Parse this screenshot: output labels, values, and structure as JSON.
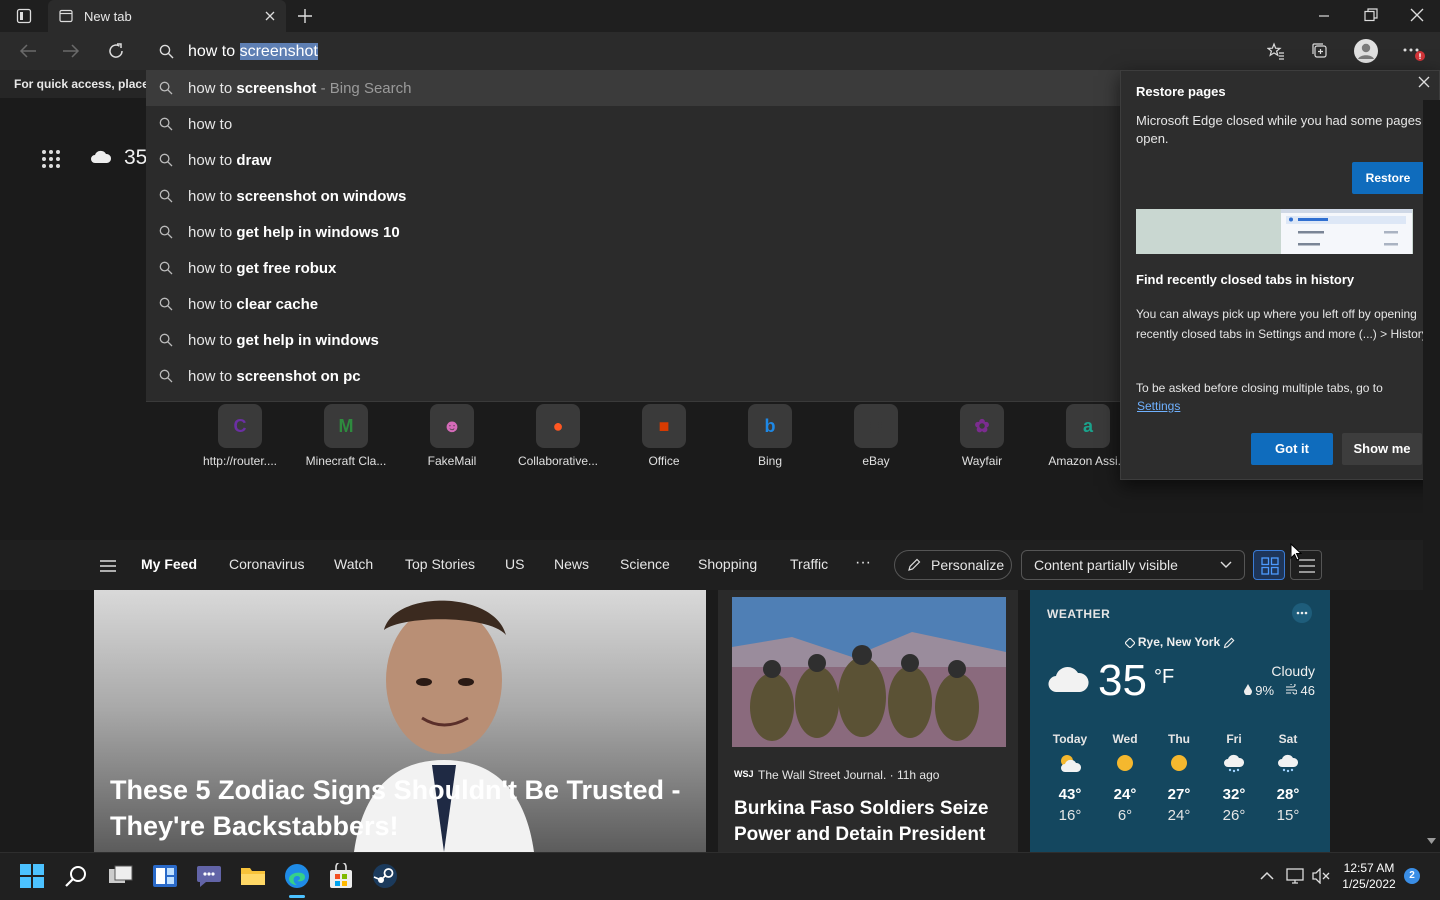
{
  "browser": {
    "tab_title": "New tab",
    "address_typed": "how to ",
    "address_selected": "screenshot",
    "favorites_hint": "For quick access, place y",
    "accent": "#0f6cbd"
  },
  "suggestions": [
    {
      "prefix": "how to ",
      "bold": "screenshot",
      "tail": " - Bing Search"
    },
    {
      "prefix": "how to",
      "bold": "",
      "tail": ""
    },
    {
      "prefix": "how to ",
      "bold": "draw",
      "tail": ""
    },
    {
      "prefix": "how to ",
      "bold": "screenshot on windows",
      "tail": ""
    },
    {
      "prefix": "how to ",
      "bold": "get help in windows 10",
      "tail": ""
    },
    {
      "prefix": "how to ",
      "bold": "get free robux",
      "tail": ""
    },
    {
      "prefix": "how to ",
      "bold": "clear cache",
      "tail": ""
    },
    {
      "prefix": "how to ",
      "bold": "get help in windows",
      "tail": ""
    },
    {
      "prefix": "how to ",
      "bold": "screenshot on pc",
      "tail": ""
    }
  ],
  "page": {
    "weather_peek": "35",
    "quick_links": [
      {
        "name": "http://router....",
        "glyph": "C",
        "color": "#6b2fa3"
      },
      {
        "name": "Minecraft Cla...",
        "glyph": "M",
        "color": "#2e8b3e"
      },
      {
        "name": "FakeMail",
        "glyph": "☻",
        "color": "#d46ab8"
      },
      {
        "name": "Collaborative...",
        "glyph": "●",
        "color": "#ff5722"
      },
      {
        "name": "Office",
        "glyph": "■",
        "color": "#d83b01"
      },
      {
        "name": "Bing",
        "glyph": "b",
        "color": "#1e88e5"
      },
      {
        "name": "eBay",
        "glyph": "▦",
        "color": "#3a3a3a"
      },
      {
        "name": "Wayfair",
        "glyph": "✿",
        "color": "#7b2c8f"
      },
      {
        "name": "Amazon Assi...",
        "glyph": "a",
        "color": "#1aa38c"
      }
    ],
    "feed_tabs": [
      "My Feed",
      "Coronavirus",
      "Watch",
      "Top Stories",
      "US",
      "News",
      "Science",
      "Shopping",
      "Traffic"
    ],
    "more_label": "···",
    "personalize_label": "Personalize",
    "content_select": "Content partially visible"
  },
  "cards": {
    "card1_headline": "These 5 Zodiac Signs Shouldn't Be Trusted - They're Backstabbers!",
    "card2_source_badge": "WSJ",
    "card2_source": "The Wall Street Journal. · 11h ago",
    "card2_headline": "Burkina Faso Soldiers Seize Power and Detain President"
  },
  "weather": {
    "header": "WEATHER",
    "location": "Rye, New York",
    "temp": "35",
    "unit": "°F",
    "condition": "Cloudy",
    "precip": "9%",
    "wind": "46",
    "forecast": [
      {
        "day": "Today",
        "hi": "43°",
        "lo": "16°",
        "icon": "partly-sunny-icon"
      },
      {
        "day": "Wed",
        "hi": "24°",
        "lo": "6°",
        "icon": "sun-icon"
      },
      {
        "day": "Thu",
        "hi": "27°",
        "lo": "24°",
        "icon": "sun-icon"
      },
      {
        "day": "Fri",
        "hi": "32°",
        "lo": "26°",
        "icon": "snow-cloud-icon"
      },
      {
        "day": "Sat",
        "hi": "28°",
        "lo": "15°",
        "icon": "snow-cloud-icon"
      }
    ]
  },
  "restore_popup": {
    "title": "Restore pages",
    "body": "Microsoft Edge closed while you had some pages open.",
    "restore_label": "Restore",
    "tip_title": "Find recently closed tabs in history",
    "tip_body": "You can always pick up where you left off by opening recently closed tabs in Settings and more (...) > History.",
    "tip_settings_text": "To be asked before closing multiple tabs, go to",
    "settings_link": "Settings",
    "got_it_label": "Got it",
    "show_me_label": "Show me"
  },
  "taskbar": {
    "time": "12:57 AM",
    "date": "1/25/2022",
    "notification_count": "2"
  }
}
